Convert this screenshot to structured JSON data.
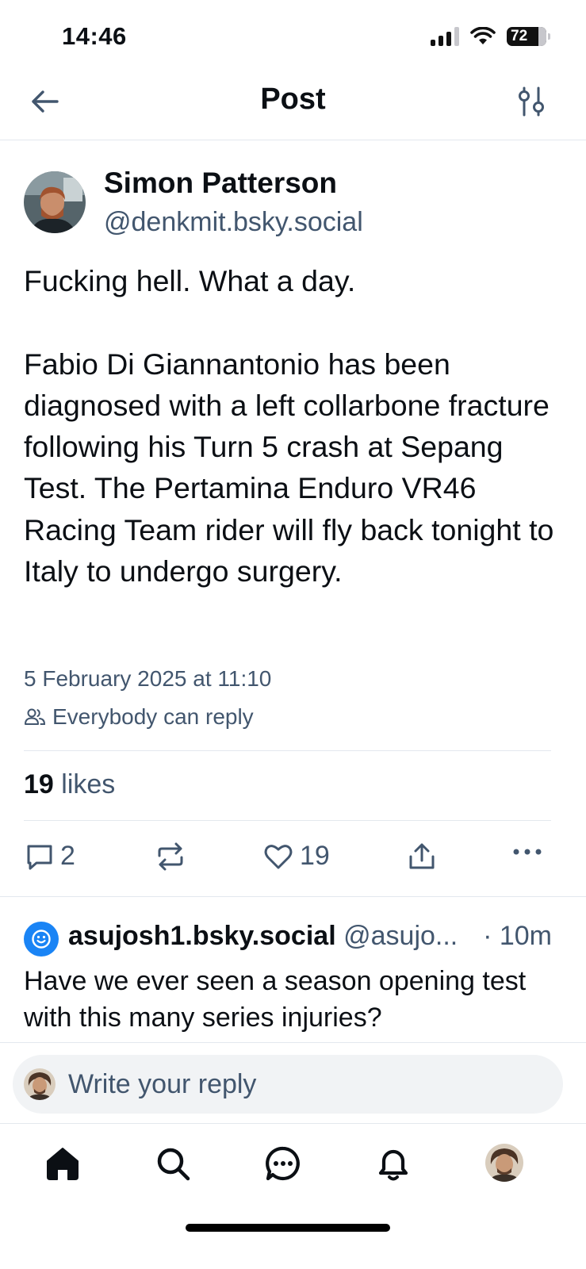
{
  "status_bar": {
    "time": "14:46",
    "battery": "72"
  },
  "header": {
    "title": "Post"
  },
  "post": {
    "author_name": "Simon Patterson",
    "author_handle": "@denkmit.bsky.social",
    "text": "Fucking hell. What a day.\n\nFabio Di Giannantonio has been diagnosed with a left collarbone fracture following his Turn 5 crash at Sepang Test. The Pertamina Enduro VR46 Racing Team rider will fly back tonight to Italy to undergo surgery.",
    "date": "5 February 2025 at 11:10",
    "reply_setting": "Everybody can reply",
    "likes_count": "19",
    "likes_label": "likes",
    "reply_count": "2",
    "like_count": "19"
  },
  "reply": {
    "name": "asujosh1.bsky.social",
    "handle": "@asujo...",
    "time": "· 10m",
    "text": "Have we ever seen a season opening test with this many series injuries?"
  },
  "composer": {
    "placeholder": "Write your reply"
  },
  "colors": {
    "accent": "#1a84f5",
    "muted": "#42566e",
    "text": "#0b0f14"
  },
  "tabs": [
    "home-icon",
    "search-icon",
    "chat-icon",
    "bell-icon",
    "profile-avatar"
  ]
}
